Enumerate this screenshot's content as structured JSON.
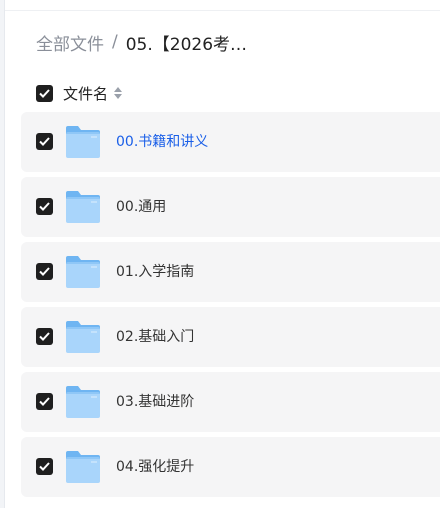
{
  "breadcrumb": {
    "root": "全部文件",
    "separator": "/",
    "current": "05.【2026考…"
  },
  "header": {
    "column_label": "文件名",
    "select_all_checked": true
  },
  "files": [
    {
      "name": "00.书籍和讲义",
      "checked": true,
      "highlighted": true
    },
    {
      "name": "00.通用",
      "checked": true,
      "highlighted": false
    },
    {
      "name": "01.入学指南",
      "checked": true,
      "highlighted": false
    },
    {
      "name": "02.基础入门",
      "checked": true,
      "highlighted": false
    },
    {
      "name": "03.基础进阶",
      "checked": true,
      "highlighted": false
    },
    {
      "name": "04.强化提升",
      "checked": true,
      "highlighted": false
    }
  ],
  "icons": {
    "checkbox": "checkbox-checked-icon",
    "folder": "folder-icon",
    "sort": "sort-icon"
  },
  "colors": {
    "link": "#1a5fe8",
    "row_bg": "#f5f5f6",
    "folder_light": "#a9d5fb",
    "folder_dark": "#6fb5f2"
  }
}
